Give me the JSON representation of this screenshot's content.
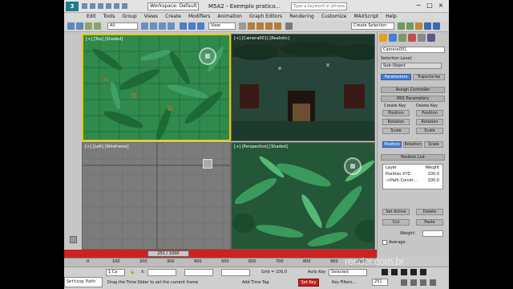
{
  "titlebar": {
    "logo": "3",
    "workspace": "Workspace: Default",
    "title": "M5A2 - Exemplo pratico...",
    "search_placeholder": "Type a keyword or phrase",
    "minimize": "−",
    "maximize": "□",
    "close": "×"
  },
  "menu": [
    "Edit",
    "Tools",
    "Group",
    "Views",
    "Create",
    "Modifiers",
    "Animation",
    "Graph Editors",
    "Rendering",
    "Customize",
    "MAXScript",
    "Help"
  ],
  "toolbar": {
    "filter": "All",
    "ref_coord": "View",
    "selection_set": "Create Selection"
  },
  "viewports": {
    "top": "[+] [Top] [Shaded]",
    "camera": "[+] [Camera001] [Realistic]",
    "left": "[+] [Left] [Wireframe]",
    "perspective": "[+] [Perspective] [Shaded]"
  },
  "cmdpanel": {
    "object_name": "Camera001",
    "selection_level": "Selection Level:",
    "sub_object": "Sub-Object",
    "tab_parameters": "Parameters",
    "tab_trajectories": "Trajectories",
    "assign_controller": "Assign Controller",
    "prs_parameters": "PRS Parameters",
    "create_key": "Create Key",
    "delete_key": "Delete Key",
    "position": "Position",
    "rotation": "Rotation",
    "scale": "Scale",
    "position_list": "Position List",
    "layer_header": "Layer",
    "weight_header": "Weight",
    "layers": [
      {
        "name": "Position XYZ",
        "weight": "100,0"
      },
      {
        "name": "->Path Constr...",
        "weight": "100,0"
      }
    ],
    "set_active": "Set Active",
    "delete": "Delete",
    "cut": "Cut",
    "paste": "Paste",
    "weight": "Weight:",
    "average_weights": "Average"
  },
  "timeline": {
    "frame_readout": "251 / 1000",
    "ticks": [
      "0",
      "100",
      "200",
      "300",
      "400",
      "500",
      "600",
      "700",
      "800",
      "900",
      "1000"
    ]
  },
  "status": {
    "maxscript": "Setting Path",
    "selected_count": "1 Ca",
    "x_label": "X:",
    "grid": "Grid = 100,0",
    "prompt": "Drag the Time Slider to set the current frame",
    "add_time_tag": "Add Time Tag",
    "auto_key": "Auto Key",
    "selected": "Selected",
    "set_key": "Set Key",
    "key_filters": "Key Filters...",
    "frame": "251"
  },
  "watermark": "render.com.br"
}
